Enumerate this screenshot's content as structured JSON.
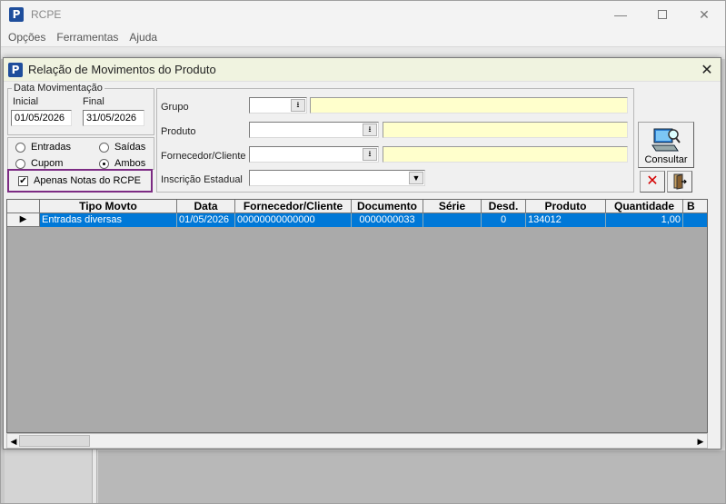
{
  "app": {
    "title": "RCPE",
    "icon_letter": "P",
    "menu": [
      "Opções",
      "Ferramentas",
      "Ajuda"
    ]
  },
  "dialog": {
    "title": "Relação de Movimentos do Produto",
    "icon_letter": "P",
    "date_group": {
      "legend": "Data Movimentação",
      "start_label": "Inicial",
      "end_label": "Final",
      "start_value": "01/05/2026",
      "end_value": "31/05/2026"
    },
    "radios": {
      "entradas": "Entradas",
      "saidas": "Saídas",
      "cupom": "Cupom",
      "ambos": "Ambos",
      "selected": "Ambos"
    },
    "checkbox": {
      "label": "Apenas Notas do RCPE",
      "checked": true
    },
    "filters": {
      "grupo_label": "Grupo",
      "produto_label": "Produto",
      "fornecedor_label": "Fornecedor/Cliente",
      "inscricao_label": "Inscrição Estadual"
    },
    "buttons": {
      "consultar_label": "Consultar"
    },
    "grid": {
      "columns": [
        "Tipo Movto",
        "Data",
        "Fornecedor/Cliente",
        "Documento",
        "Série",
        "Desd.",
        "Produto",
        "Quantidade",
        "B"
      ],
      "rows": [
        {
          "tipo": "Entradas diversas",
          "data": "01/05/2026",
          "fornecedor": "00000000000000",
          "documento": "0000000033",
          "serie": "",
          "desd": "0",
          "produto": "134012",
          "quantidade": "1,00",
          "b": ""
        }
      ]
    }
  },
  "colors": {
    "selection": "#0078d7",
    "highlight_border": "#7c2b83",
    "yellow_field": "#ffffcc"
  }
}
